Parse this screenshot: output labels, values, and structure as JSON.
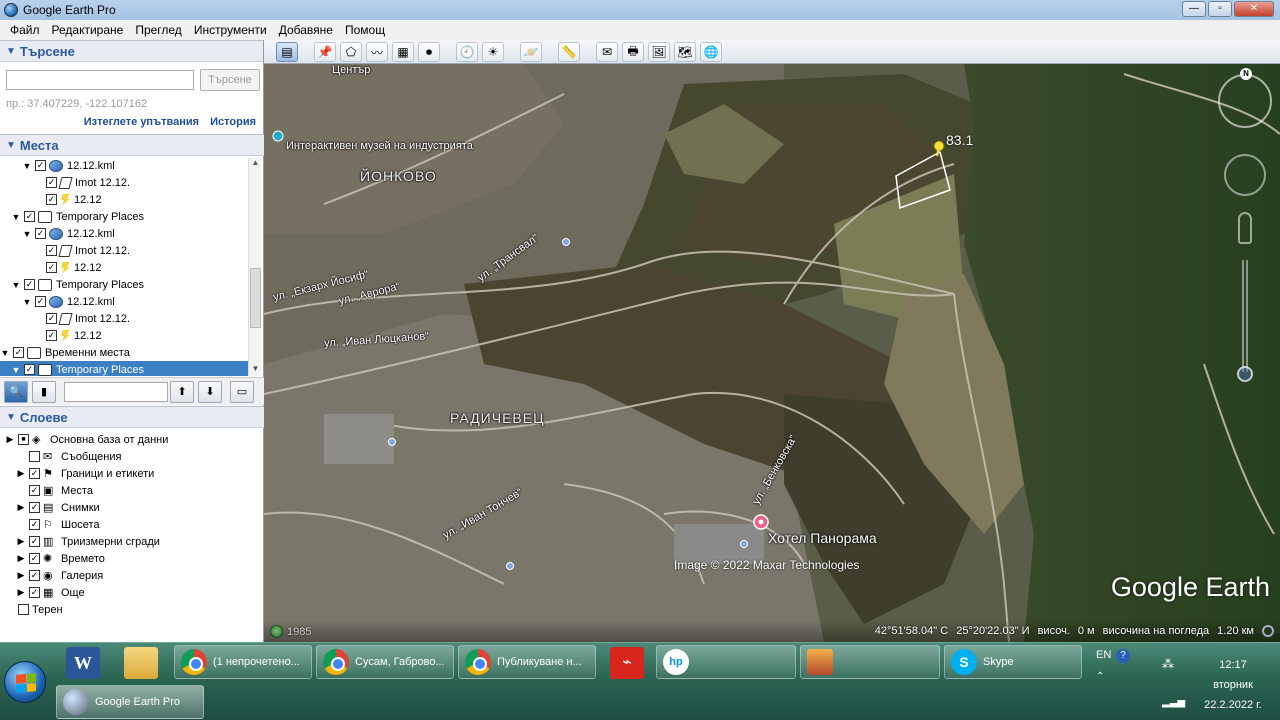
{
  "window": {
    "title": "Google Earth Pro",
    "minimize": "—",
    "maximize": "▫",
    "close": "✕"
  },
  "menu": [
    "Файл",
    "Редактиране",
    "Преглед",
    "Инструменти",
    "Добавяне",
    "Помощ"
  ],
  "search": {
    "header": "Търсене",
    "button": "Търсене",
    "hint": "пр.: 37.407229, -122.107162",
    "clear_link": "Изтеглете упътвания",
    "history_link": "История",
    "value": ""
  },
  "places": {
    "header": "Места",
    "items": [
      {
        "label": "12.12.kml",
        "icon": "kml-icon",
        "indent": 1,
        "expanded": true,
        "checked": true
      },
      {
        "label": "Imot 12.12.",
        "icon": "polygon-icon",
        "indent": 2,
        "checked": true
      },
      {
        "label": "12.12",
        "icon": "pin-icon",
        "indent": 2,
        "checked": true
      },
      {
        "label": "Temporary Places",
        "icon": "folder-icon",
        "indent": 0,
        "expanded": true,
        "checked": true
      },
      {
        "label": "12.12.kml",
        "icon": "kml-icon",
        "indent": 1,
        "expanded": true,
        "checked": true
      },
      {
        "label": "Imot 12.12.",
        "icon": "polygon-icon",
        "indent": 2,
        "checked": true
      },
      {
        "label": "12.12",
        "icon": "pin-icon",
        "indent": 2,
        "checked": true
      },
      {
        "label": "Temporary Places",
        "icon": "folder-icon",
        "indent": 0,
        "expanded": true,
        "checked": true
      },
      {
        "label": "12.12.kml",
        "icon": "kml-icon",
        "indent": 1,
        "expanded": true,
        "checked": true
      },
      {
        "label": "Imot 12.12.",
        "icon": "polygon-icon",
        "indent": 2,
        "checked": true
      },
      {
        "label": "12.12",
        "icon": "pin-icon",
        "indent": 2,
        "checked": true
      },
      {
        "label": "Временни места",
        "icon": "folder-icon",
        "indent": -1,
        "expanded": true,
        "checked": true
      },
      {
        "label": "Temporary Places",
        "icon": "folder-icon",
        "indent": 0,
        "expanded": true,
        "checked": true,
        "selected": true
      }
    ]
  },
  "layers": {
    "header": "Слоеве",
    "items": [
      {
        "label": "Основна база от данни",
        "icon": "database-icon",
        "indent": 0,
        "expandable": true
      },
      {
        "label": "Съобщения",
        "icon": "envelope-icon",
        "indent": 1,
        "checked": false
      },
      {
        "label": "Граници и етикети",
        "icon": "flag-icon",
        "indent": 1,
        "expandable": true,
        "checked": true
      },
      {
        "label": "Места",
        "icon": "places-icon",
        "indent": 1,
        "checked": true
      },
      {
        "label": "Снимки",
        "icon": "photo-icon",
        "indent": 1,
        "expandable": true,
        "checked": true
      },
      {
        "label": "Шосета",
        "icon": "road-icon",
        "indent": 1,
        "checked": true
      },
      {
        "label": "Триизмерни сгради",
        "icon": "building-icon",
        "indent": 1,
        "expandable": true,
        "checked": true
      },
      {
        "label": "Времето",
        "icon": "weather-icon",
        "indent": 1,
        "expandable": true,
        "checked": true
      },
      {
        "label": "Галерия",
        "icon": "gallery-icon",
        "indent": 1,
        "expandable": true,
        "checked": true
      },
      {
        "label": "Още",
        "icon": "more-icon",
        "indent": 1,
        "expandable": true,
        "checked": true
      },
      {
        "label": "Терен",
        "icon": "",
        "indent": 0,
        "checked": false
      }
    ]
  },
  "map": {
    "labels": {
      "museum": "Интерактивен музей на индустрията",
      "ionkovo": "ЙОНКОВО",
      "radichevets": "РАДИЧЕВЕЦ",
      "street1": "ул. „Екзарх Йосиф“",
      "street2": "ул. „Аврора“",
      "street3": "ул. „Иван Люцканов“",
      "street4": "ул. „Бенковска“",
      "street5": "ул. „Иван Тончев“",
      "street6": "ул. „Трансвал“",
      "hotel": "Хотел Панорама",
      "top": "Център"
    },
    "pin_label": "83.1",
    "copyright": "Image © 2022 Maxar Technologies",
    "logo": "Google Earth",
    "year": "1985",
    "compass_n": "N",
    "status": {
      "lat": "42°51'58.04\" С",
      "lon": "25°20'22.03\" И",
      "elev_label": "височ.",
      "elev_value": "0 м",
      "eye_label": "височина на погледа",
      "eye_value": "1.20 км"
    }
  },
  "taskbar": {
    "tasks": [
      {
        "label": "(1 непрочетено...",
        "icon": "chrome-icon"
      },
      {
        "label": "Сусам, Габрово...",
        "icon": "chrome-icon"
      },
      {
        "label": "Публикуване н...",
        "icon": "chrome-icon"
      },
      {
        "label": "Skype",
        "icon": "skype-icon"
      },
      {
        "label": "Google Earth Pro",
        "icon": "google-earth-icon"
      }
    ],
    "lang": "EN",
    "time": "12:17",
    "day": "вторник",
    "date": "22.2.2022 г."
  }
}
